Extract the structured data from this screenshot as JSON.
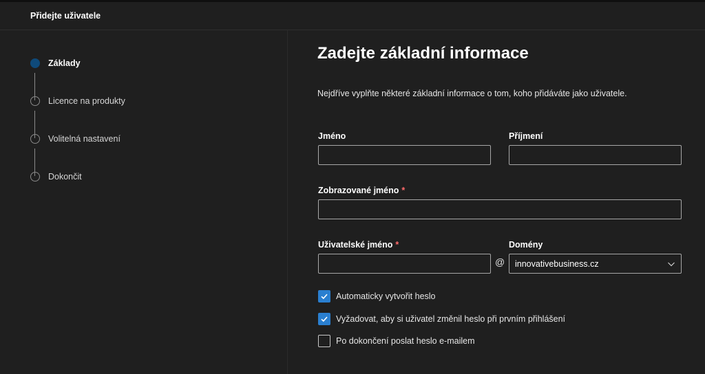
{
  "header": {
    "title": "Přidejte uživatele"
  },
  "steps": [
    {
      "label": "Základy",
      "active": true
    },
    {
      "label": "Licence na produkty",
      "active": false
    },
    {
      "label": "Volitelná nastavení",
      "active": false
    },
    {
      "label": "Dokončit",
      "active": false
    }
  ],
  "main": {
    "title": "Zadejte základní informace",
    "intro": "Nejdříve vyplňte některé základní informace o tom, koho přidáváte jako uživatele.",
    "fields": {
      "first_name": {
        "label": "Jméno",
        "value": ""
      },
      "last_name": {
        "label": "Příjmení",
        "value": ""
      },
      "display_name": {
        "label": "Zobrazované jméno",
        "required_mark": "*",
        "value": ""
      },
      "username": {
        "label": "Uživatelské jméno",
        "required_mark": "*",
        "value": ""
      },
      "at_sign": "@",
      "domains": {
        "label": "Domény",
        "selected": "innovativebusiness.cz"
      }
    },
    "checkboxes": [
      {
        "label": "Automaticky vytvořit heslo",
        "checked": true
      },
      {
        "label": "Vyžadovat, aby si uživatel změnil heslo při prvním přihlášení",
        "checked": true
      },
      {
        "label": "Po dokončení poslat heslo e-mailem",
        "checked": false
      }
    ]
  },
  "colors": {
    "background": "#1f1f1f",
    "accent": "#2a7fd0",
    "active_step": "#0f4a7a",
    "required": "#ff6b6b"
  },
  "icons": {
    "dropdown": "chevron-down-icon",
    "checkmark": "checkmark-icon"
  }
}
